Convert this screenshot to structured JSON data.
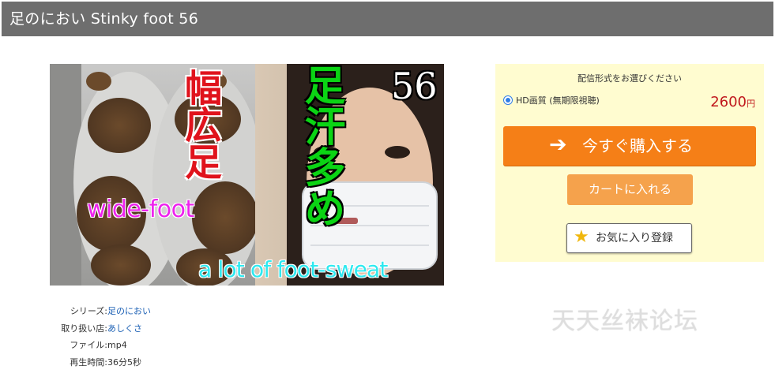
{
  "header": {
    "title": "足のにおい Stinky foot 56"
  },
  "product_image": {
    "text_red_vertical": "幅広足",
    "text_green_vertical": "足汗多め",
    "episode_number": "56",
    "text_wide_foot": "wide-foot",
    "text_sweat": "a lot of foot-sweat"
  },
  "details": {
    "series": {
      "label": "シリーズ:",
      "value": "足のにおい"
    },
    "store": {
      "label": "取り扱い店:",
      "value": "あしくさ"
    },
    "file": {
      "label": "ファイル:",
      "value": "mp4"
    },
    "duration": {
      "label": "再生時間:",
      "value": "36分5秒"
    }
  },
  "purchase": {
    "format_title": "配信形式をお選びください",
    "option_label": "HD画質 (無期限視聴)",
    "option_selected": true,
    "price": "2600",
    "price_unit": "円",
    "buy_label": "今すぐ購入する",
    "buy_icon": "arrow-right-icon",
    "cart_label": "カートに入れる",
    "favorite_label": "お気に入り登録",
    "favorite_icon": "star-icon"
  },
  "watermark": "天天丝袜论坛",
  "colors": {
    "header_bg": "#6e6e6e",
    "purchase_bg": "#fffcd0",
    "buy_button": "#f57f17",
    "cart_button": "#f5a24c",
    "price": "#c0171c",
    "link": "#1a5fb4",
    "radio": "#2f7ee6"
  }
}
